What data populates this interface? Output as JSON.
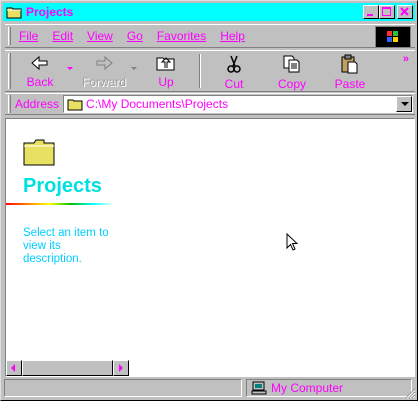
{
  "window": {
    "title": "Projects",
    "minimize_glyph": "_",
    "maximize_glyph": "□",
    "close_glyph": "×"
  },
  "menu": {
    "items": [
      {
        "label": "File",
        "icon": null
      },
      {
        "label": "Edit"
      },
      {
        "label": "View"
      },
      {
        "label": "Go"
      },
      {
        "label": "Favorites"
      },
      {
        "label": "Help"
      }
    ]
  },
  "toolbar": {
    "back_label": "Back",
    "forward_label": "Forward",
    "up_label": "Up",
    "cut_label": "Cut",
    "copy_label": "Copy",
    "paste_label": "Paste",
    "more_glyph": "»"
  },
  "address": {
    "label": "Address",
    "value": "C:\\My Documents\\Projects"
  },
  "content": {
    "folder_title": "Projects",
    "description": "Select an item to view its description."
  },
  "status": {
    "zone_label": "My Computer"
  },
  "colors": {
    "title_bar": "#00ffff",
    "text_accent": "#ff00ff",
    "folder_title": "#00e0e0",
    "description": "#00d0ff"
  }
}
